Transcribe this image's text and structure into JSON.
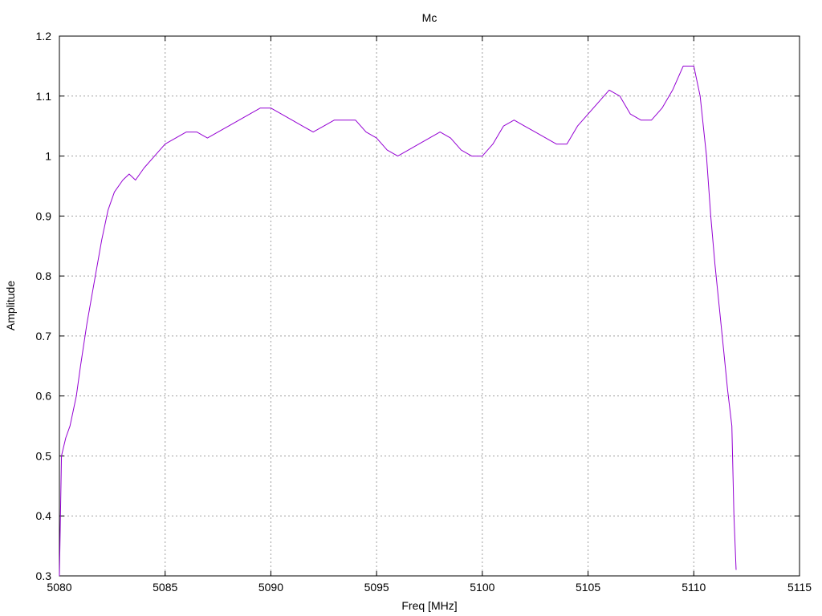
{
  "chart_data": {
    "type": "line",
    "title": "Mc",
    "xlabel": "Freq [MHz]",
    "ylabel": "Amplitude",
    "xlim": [
      5080,
      5115
    ],
    "ylim": [
      0.3,
      1.2
    ],
    "x_ticks": [
      5080,
      5085,
      5090,
      5095,
      5100,
      5105,
      5110,
      5115
    ],
    "x_tick_labels": [
      "5080",
      "5085",
      "5090",
      "5095",
      "5100",
      "5105",
      "5110",
      "5115"
    ],
    "y_ticks": [
      0.3,
      0.4,
      0.5,
      0.6,
      0.7,
      0.8,
      0.9,
      1.0,
      1.1,
      1.2
    ],
    "y_tick_labels": [
      "0.3",
      "0.4",
      "0.5",
      "0.6",
      "0.7",
      "0.8",
      "0.9",
      "1",
      "1.1",
      "1.2"
    ],
    "grid": true,
    "series": [
      {
        "color": "#9400d3",
        "x": [
          5080.0,
          5080.1,
          5080.3,
          5080.5,
          5080.8,
          5081.0,
          5081.3,
          5081.6,
          5082.0,
          5082.3,
          5082.6,
          5083.0,
          5083.3,
          5083.6,
          5084.0,
          5084.5,
          5085.0,
          5085.5,
          5086.0,
          5086.5,
          5087.0,
          5087.5,
          5088.0,
          5088.5,
          5089.0,
          5089.5,
          5090.0,
          5090.5,
          5091.0,
          5091.5,
          5092.0,
          5092.5,
          5093.0,
          5093.5,
          5094.0,
          5094.5,
          5095.0,
          5095.5,
          5096.0,
          5096.5,
          5097.0,
          5097.5,
          5098.0,
          5098.5,
          5099.0,
          5099.5,
          5100.0,
          5100.5,
          5101.0,
          5101.5,
          5102.0,
          5102.5,
          5103.0,
          5103.5,
          5104.0,
          5104.5,
          5105.0,
          5105.5,
          5106.0,
          5106.5,
          5107.0,
          5107.5,
          5108.0,
          5108.5,
          5109.0,
          5109.5,
          5110.0,
          5110.3,
          5110.6,
          5110.8,
          5111.0,
          5111.2,
          5111.4,
          5111.6,
          5111.8,
          5111.9,
          5112.0
        ],
        "y": [
          0.3,
          0.5,
          0.53,
          0.55,
          0.6,
          0.65,
          0.72,
          0.78,
          0.86,
          0.91,
          0.94,
          0.96,
          0.97,
          0.96,
          0.98,
          1.0,
          1.02,
          1.03,
          1.04,
          1.04,
          1.03,
          1.04,
          1.05,
          1.06,
          1.07,
          1.08,
          1.08,
          1.07,
          1.06,
          1.05,
          1.04,
          1.05,
          1.06,
          1.06,
          1.06,
          1.04,
          1.03,
          1.01,
          1.0,
          1.01,
          1.02,
          1.03,
          1.04,
          1.03,
          1.01,
          1.0,
          1.0,
          1.02,
          1.05,
          1.06,
          1.05,
          1.04,
          1.03,
          1.02,
          1.02,
          1.05,
          1.07,
          1.09,
          1.11,
          1.1,
          1.07,
          1.06,
          1.06,
          1.08,
          1.11,
          1.15,
          1.15,
          1.1,
          1.0,
          0.9,
          0.82,
          0.75,
          0.68,
          0.61,
          0.55,
          0.4,
          0.31
        ]
      }
    ]
  }
}
